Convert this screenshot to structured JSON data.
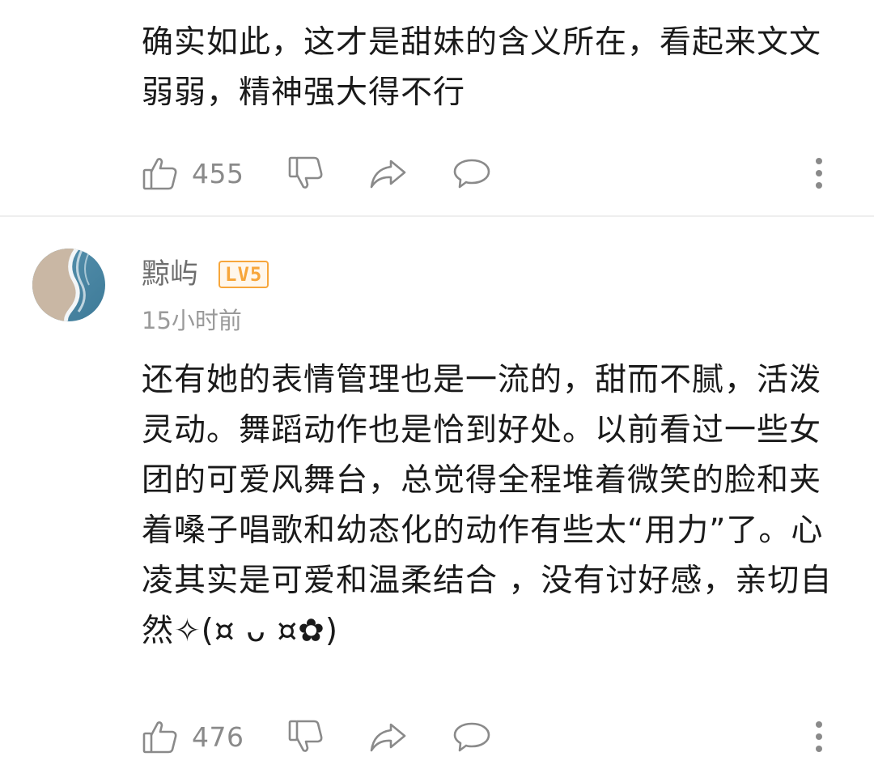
{
  "comments": [
    {
      "text": "确实如此，这才是甜妹的含义所在，看起来文文弱弱，精神强大得不行",
      "likes": "455"
    },
    {
      "username": "黥屿",
      "level": "LV5",
      "time": "15小时前",
      "text": "还有她的表情管理也是一流的，甜而不腻，活泼灵动。舞蹈动作也是恰到好处。以前看过一些女团的可爱风舞台，总觉得全程堆着微笑的脸和夹着嗓子唱歌和幼态化的动作有些太“用力”了。心凌其实是可爱和温柔结合 ，没有讨好感，亲切自然✧(¤ ᴗ ¤✿)",
      "likes": "476"
    }
  ],
  "icons": {
    "like": "thumbs-up-icon",
    "dislike": "thumbs-down-icon",
    "share": "share-arrow-icon",
    "reply": "comment-bubble-icon",
    "more": "more-vertical-icon"
  },
  "colors": {
    "icon_gray": "#8a8a8a",
    "badge_orange": "#f7a63b",
    "text_dark": "#1a1a1a"
  }
}
